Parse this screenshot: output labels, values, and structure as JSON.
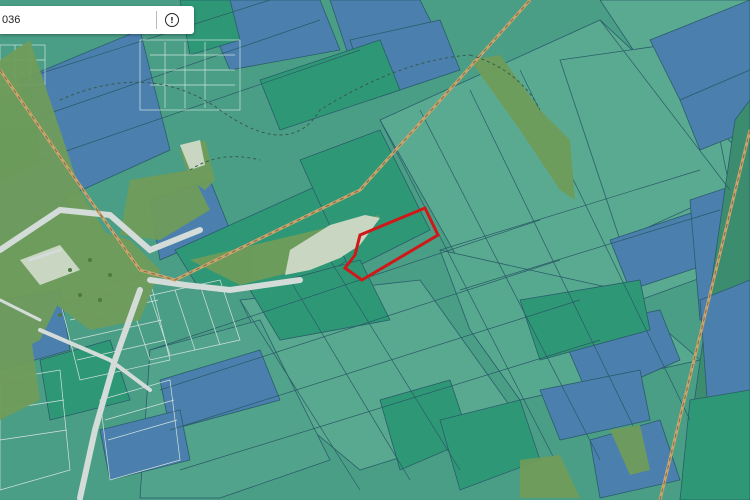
{
  "search": {
    "value": "036",
    "info_icon": "info-icon",
    "info_glyph": "!"
  },
  "colors": {
    "base": "#4a9e86",
    "parcel_blue": "#4a7fae",
    "parcel_green": "#2e9876",
    "parcel_teal": "#5aaa92",
    "vegetation": "#6f9c5a",
    "road": "#cfd8d3",
    "highlight": "#d01818",
    "railway": "#c9a46a"
  },
  "map": {
    "selected_parcel": "red-outline",
    "labels": []
  }
}
